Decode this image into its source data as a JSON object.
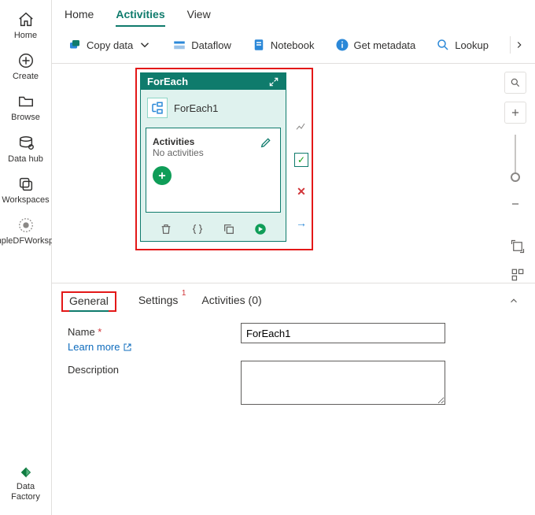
{
  "sidebar": {
    "home": "Home",
    "create": "Create",
    "browse": "Browse",
    "dataHub": "Data hub",
    "workspaces": "Workspaces",
    "sampleWorkspace": "SampleDFWorkspace",
    "dataFactory": "Data Factory"
  },
  "topTabs": {
    "home": "Home",
    "activities": "Activities",
    "view": "View"
  },
  "toolbar": {
    "copyData": "Copy data",
    "dataflow": "Dataflow",
    "notebook": "Notebook",
    "getMetadata": "Get metadata",
    "lookup": "Lookup"
  },
  "card": {
    "type": "ForEach",
    "name": "ForEach1",
    "sectionTitle": "Activities",
    "empty": "No activities"
  },
  "bottomTabs": {
    "general": "General",
    "settings": "Settings",
    "settingsBadge": "1",
    "activities": "Activities (0)"
  },
  "form": {
    "nameLabel": "Name",
    "nameValue": "ForEach1",
    "learnMore": "Learn more",
    "descriptionLabel": "Description",
    "descriptionValue": ""
  }
}
